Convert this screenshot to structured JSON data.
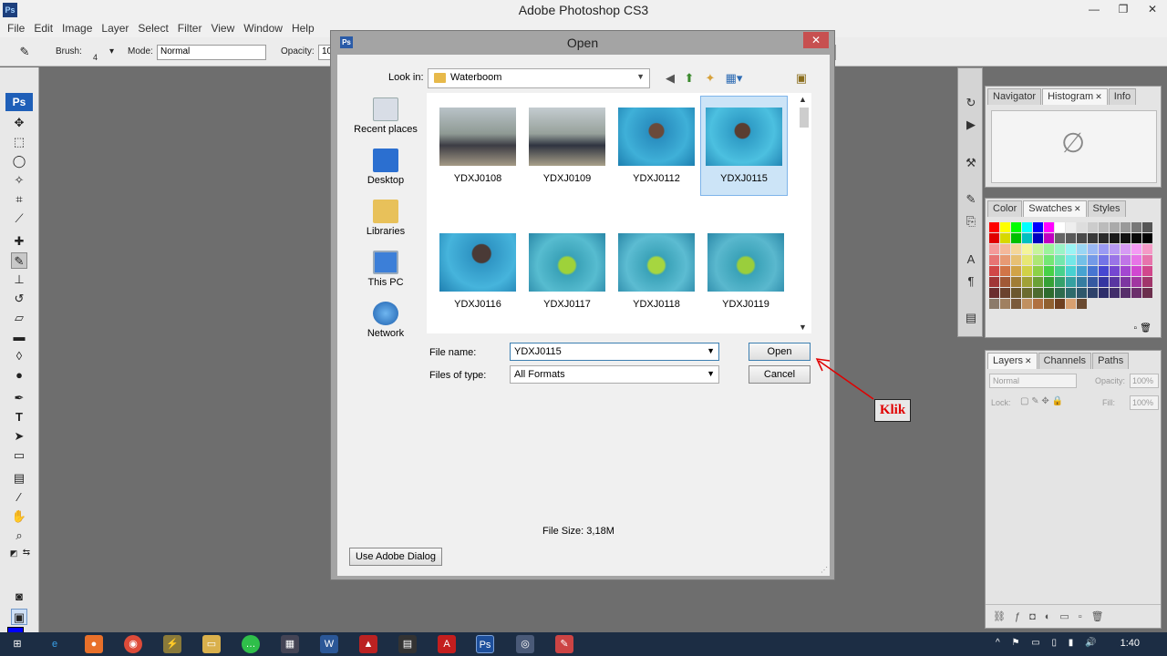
{
  "app": {
    "title": "Adobe Photoshop CS3",
    "logo": "Ps",
    "menu": [
      "File",
      "Edit",
      "Image",
      "Layer",
      "Select",
      "Filter",
      "View",
      "Window",
      "Help"
    ]
  },
  "options_bar": {
    "brush_label": "Brush:",
    "brush_size": "4",
    "mode_label": "Mode:",
    "mode_value": "Normal",
    "opacity_label": "Opacity:",
    "opacity_value": "10"
  },
  "toolbox": {
    "badge": "Ps",
    "foreground_color": "#0000ff",
    "background_color": "#000080"
  },
  "panels": {
    "top_tabs": [
      "Navigator",
      "Histogram",
      "Info"
    ],
    "color_tabs": [
      "Color",
      "Swatches",
      "Styles"
    ],
    "layer_tabs": [
      "Layers",
      "Channels",
      "Paths"
    ],
    "layers_blend": "Normal",
    "layers_opacity_label": "Opacity:",
    "layers_opacity": "100%",
    "lock_label": "Lock:",
    "fill_label": "Fill:",
    "fill_value": "100%"
  },
  "dialog": {
    "title": "Open",
    "logo": "Ps",
    "look_in_label": "Look in:",
    "look_in_value": "Waterboom",
    "places": [
      "Recent places",
      "Desktop",
      "Libraries",
      "This PC",
      "Network"
    ],
    "files": [
      {
        "name": "YDXJ0108",
        "selected": false
      },
      {
        "name": "YDXJ0109",
        "selected": false
      },
      {
        "name": "YDXJ0112",
        "selected": false
      },
      {
        "name": "YDXJ0115",
        "selected": true
      },
      {
        "name": "YDXJ0116",
        "selected": false
      },
      {
        "name": "YDXJ0117",
        "selected": false
      },
      {
        "name": "YDXJ0118",
        "selected": false
      },
      {
        "name": "YDXJ0119",
        "selected": false
      }
    ],
    "file_name_label": "File name:",
    "file_name_value": "YDXJ0115",
    "file_type_label": "Files of type:",
    "file_type_value": "All Formats",
    "open_button": "Open",
    "cancel_button": "Cancel",
    "file_size": "File Size: 3,18M",
    "adobe_dialog_button": "Use Adobe Dialog"
  },
  "annotation": {
    "text": "Klik",
    "color": "#e00000"
  },
  "taskbar": {
    "time": "1:40"
  }
}
